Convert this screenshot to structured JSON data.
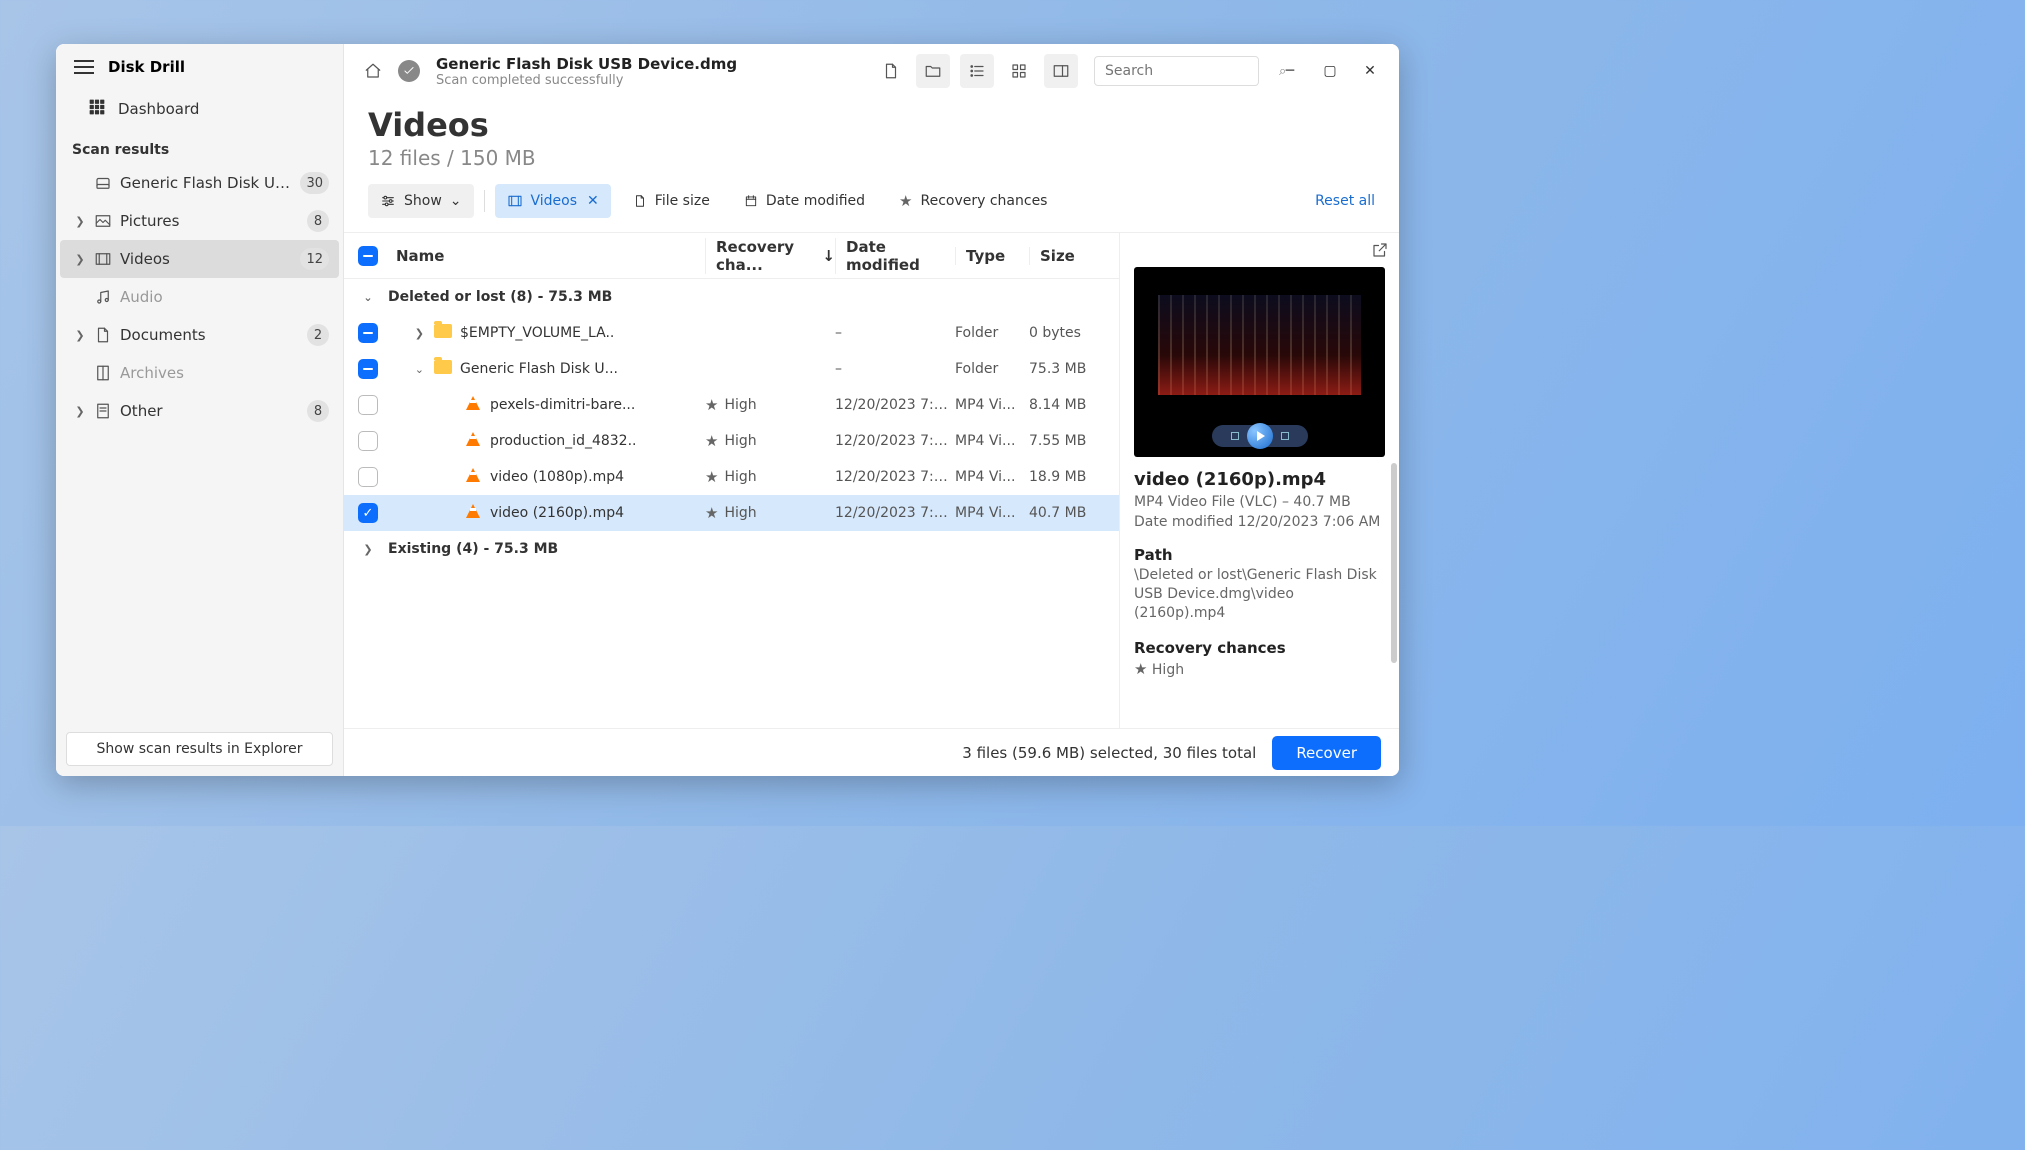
{
  "app_title": "Disk Drill",
  "sidebar": {
    "dashboard": "Dashboard",
    "section": "Scan results",
    "items": [
      {
        "label": "Generic Flash Disk USB D...",
        "count": "30",
        "expandable": false
      },
      {
        "label": "Pictures",
        "count": "8",
        "expandable": true
      },
      {
        "label": "Videos",
        "count": "12",
        "expandable": true,
        "active": true
      },
      {
        "label": "Audio",
        "count": "",
        "muted": true
      },
      {
        "label": "Documents",
        "count": "2",
        "expandable": true
      },
      {
        "label": "Archives",
        "count": "",
        "muted": true
      },
      {
        "label": "Other",
        "count": "8",
        "expandable": true
      }
    ],
    "footer_btn": "Show scan results in Explorer"
  },
  "header": {
    "title": "Generic Flash Disk USB Device.dmg",
    "subtitle": "Scan completed successfully",
    "search_placeholder": "Search"
  },
  "content": {
    "title": "Videos",
    "subtitle": "12 files / 150 MB"
  },
  "chips": {
    "show": "Show",
    "videos": "Videos",
    "filesize": "File size",
    "datemod": "Date modified",
    "recchance": "Recovery chances",
    "reset": "Reset all"
  },
  "columns": {
    "name": "Name",
    "rec": "Recovery cha...",
    "date": "Date modified",
    "type": "Type",
    "size": "Size"
  },
  "groups": [
    {
      "label": "Deleted or lost (8) - 75.3 MB",
      "expanded": true
    },
    {
      "label": "Existing (4) - 75.3 MB",
      "expanded": false
    }
  ],
  "rows": [
    {
      "cb": "part",
      "kind": "folder",
      "name": "$EMPTY_VOLUME_LA..",
      "rec": "",
      "date": "–",
      "type": "Folder",
      "size": "0 bytes",
      "indent": 1,
      "arrow": "right"
    },
    {
      "cb": "part",
      "kind": "folder",
      "name": "Generic Flash Disk U...",
      "rec": "",
      "date": "–",
      "type": "Folder",
      "size": "75.3 MB",
      "indent": 1,
      "arrow": "down"
    },
    {
      "cb": "off",
      "kind": "video",
      "name": "pexels-dimitri-bare...",
      "rec": "High",
      "date": "12/20/2023 7:07...",
      "type": "MP4 Vi...",
      "size": "8.14 MB",
      "indent": 2
    },
    {
      "cb": "off",
      "kind": "video",
      "name": "production_id_4832..",
      "rec": "High",
      "date": "12/20/2023 7:07...",
      "type": "MP4 Vi...",
      "size": "7.55 MB",
      "indent": 2
    },
    {
      "cb": "off",
      "kind": "video",
      "name": "video (1080p).mp4",
      "rec": "High",
      "date": "12/20/2023 7:06...",
      "type": "MP4 Vi...",
      "size": "18.9 MB",
      "indent": 2
    },
    {
      "cb": "on",
      "kind": "video",
      "name": "video (2160p).mp4",
      "rec": "High",
      "date": "12/20/2023 7:06...",
      "type": "MP4 Vi...",
      "size": "40.7 MB",
      "indent": 2,
      "selected": true
    }
  ],
  "preview": {
    "title": "video (2160p).mp4",
    "typeline": "MP4 Video File (VLC) – 40.7 MB",
    "dateline": "Date modified 12/20/2023 7:06 AM",
    "path_label": "Path",
    "path_value": "\\Deleted or lost\\Generic Flash Disk USB Device.dmg\\video (2160p).mp4",
    "rec_label": "Recovery chances",
    "rec_value": "High"
  },
  "footer": {
    "status": "3 files (59.6 MB) selected, 30 files total",
    "recover": "Recover"
  }
}
